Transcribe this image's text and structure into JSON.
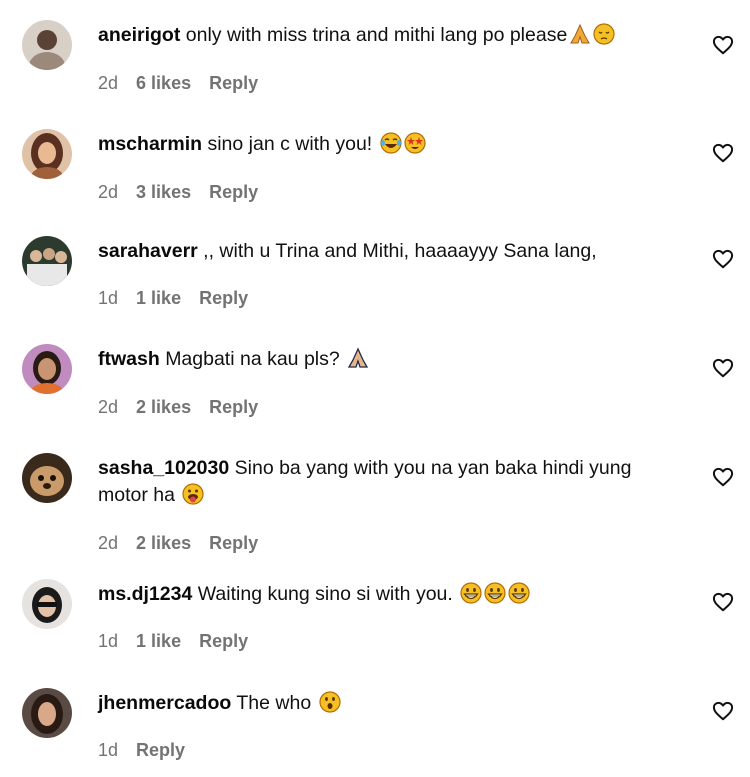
{
  "comments": [
    {
      "username": "aneirigot",
      "text": "only with miss trina and mithi lang po please",
      "emojis": [
        "folded-hands-emoji",
        "pensive-face-emoji"
      ],
      "time": "2d",
      "likes": "6 likes",
      "reply": "Reply",
      "avatar_color": "#c9b7a6"
    },
    {
      "username": "mscharmin",
      "text": "sino jan c with you!",
      "emojis": [
        "tears-of-joy-emoji",
        "star-struck-emoji"
      ],
      "time": "2d",
      "likes": "3 likes",
      "reply": "Reply",
      "avatar_color": "#8a5a3c"
    },
    {
      "username": "sarahaverr",
      "text": ",, with u Trina and Mithi, haaaayyy Sana lang,",
      "emojis": [],
      "time": "1d",
      "likes": "1 like",
      "reply": "Reply",
      "avatar_color": "#3a4a3a"
    },
    {
      "username": "ftwash",
      "text": "Magbati na kau pls?",
      "emojis": [
        "folded-hands-emoji"
      ],
      "time": "2d",
      "likes": "2 likes",
      "reply": "Reply",
      "avatar_color": "#b06aa8"
    },
    {
      "username": "sasha_102030",
      "text": "Sino ba yang with you na yan baka hindi yung",
      "text_line2": "motor ha",
      "emojis": [
        "tongue-face-emoji"
      ],
      "time": "2d",
      "likes": "2 likes",
      "reply": "Reply",
      "avatar_color": "#7b5a3a"
    },
    {
      "username": "ms.dj1234",
      "text": "Waiting kung sino si with you.",
      "emojis": [
        "grinning-face-emoji",
        "grinning-face-emoji",
        "grinning-face-emoji"
      ],
      "time": "1d",
      "likes": "1 like",
      "reply": "Reply",
      "avatar_color": "#6a6a6a"
    },
    {
      "username": "jhenmercadoo",
      "text": "The who",
      "emojis": [
        "hushed-face-emoji"
      ],
      "time": "1d",
      "likes": "",
      "reply": "Reply",
      "avatar_color": "#4a3a34"
    }
  ],
  "colors": {
    "meta_gray": "#737373",
    "emoji_yellow": "#f5c023",
    "emoji_outline": "#b36b00"
  }
}
